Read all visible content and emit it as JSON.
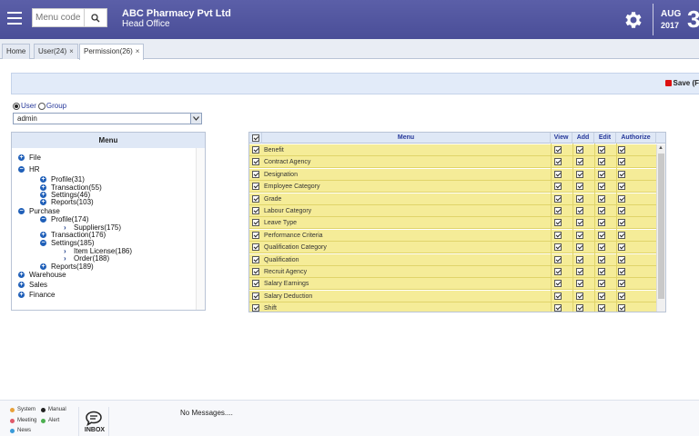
{
  "header": {
    "search_placeholder": "Menu code",
    "company": "ABC Pharmacy Pvt Ltd",
    "branch": "Head Office",
    "month": "AUG",
    "year": "2017",
    "day": "3"
  },
  "tabs": [
    {
      "label": "Home"
    },
    {
      "label": "User(24)",
      "close": "×"
    },
    {
      "label": "Permission(26)",
      "close": "×"
    }
  ],
  "toolbar": {
    "save_label": "Save (F"
  },
  "filter": {
    "user_label": "User",
    "group_label": "Group",
    "selected_mode": "User",
    "select_value": "admin"
  },
  "tree": {
    "header": "Menu",
    "nodes": [
      {
        "label": "File",
        "icon": "plus"
      },
      {
        "label": "HR",
        "icon": "minus"
      },
      {
        "label": "Profile(31)",
        "icon": "plus"
      },
      {
        "label": "Transaction(55)",
        "icon": "plus"
      },
      {
        "label": "Settings(46)",
        "icon": "plus"
      },
      {
        "label": "Reports(103)",
        "icon": "plus"
      },
      {
        "label": "Purchase",
        "icon": "minus"
      },
      {
        "label": "Profile(174)",
        "icon": "minus"
      },
      {
        "label": "Suppliers(175)",
        "icon": "chevron"
      },
      {
        "label": "Transaction(176)",
        "icon": "plus"
      },
      {
        "label": "Settings(185)",
        "icon": "minus"
      },
      {
        "label": "Item License(186)",
        "icon": "chevron"
      },
      {
        "label": "Order(188)",
        "icon": "chevron"
      },
      {
        "label": "Reports(189)",
        "icon": "plus"
      },
      {
        "label": "Warehouse",
        "icon": "plus"
      },
      {
        "label": "Sales",
        "icon": "plus"
      },
      {
        "label": "Finance",
        "icon": "plus"
      }
    ]
  },
  "grid": {
    "columns": [
      "Menu",
      "View",
      "Add",
      "Edit",
      "Authorize"
    ],
    "rows": [
      "Benefit",
      "Contract Agency",
      "Designation",
      "Employee Category",
      "Grade",
      "Labour Category",
      "Leave Type",
      "Performance Criteria",
      "Qualification Category",
      "Qualification",
      "Recruit Agency",
      "Salary Earnings",
      "Salary Deduction",
      "Shift"
    ]
  },
  "footer": {
    "legend": [
      {
        "label": "System",
        "color": "#e8a13a"
      },
      {
        "label": "Manual",
        "color": "#222222"
      },
      {
        "label": "Meeting",
        "color": "#e05a6a"
      },
      {
        "label": "Alert",
        "color": "#4caf50"
      },
      {
        "label": "News",
        "color": "#3a9ad9"
      }
    ],
    "inbox_label": "INBOX",
    "message": "No Messages...."
  }
}
